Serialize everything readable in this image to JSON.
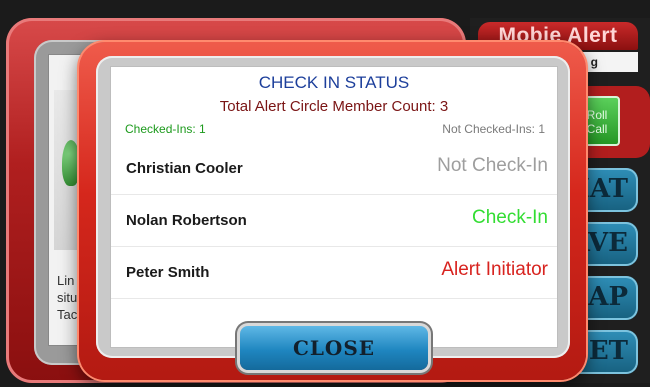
{
  "background": {
    "app_title": "Mobie Alert",
    "app_subtitle_fragment": "g",
    "text_fragments": [
      "Lin",
      "situ",
      "Tac"
    ],
    "roll_call_label": "Roll\nCall",
    "side_buttons": [
      "HAT",
      "AVE",
      "AP",
      "ESET"
    ]
  },
  "modal": {
    "title": "CHECK IN STATUS",
    "member_count_text": "Total Alert Circle Member Count: 3",
    "checked_ins_text": "Checked-Ins: 1",
    "not_checked_ins_text": "Not Checked-Ins: 1",
    "members": [
      {
        "name": "Christian Cooler",
        "status": "Not Check-In",
        "status_color": "#9e9e9e"
      },
      {
        "name": "Nolan Robertson",
        "status": "Check-In",
        "status_color": "#33dd33"
      },
      {
        "name": "Peter Smith",
        "status": "Alert Initiator",
        "status_color": "#d8231f"
      }
    ],
    "close_label": "CLOSE"
  }
}
